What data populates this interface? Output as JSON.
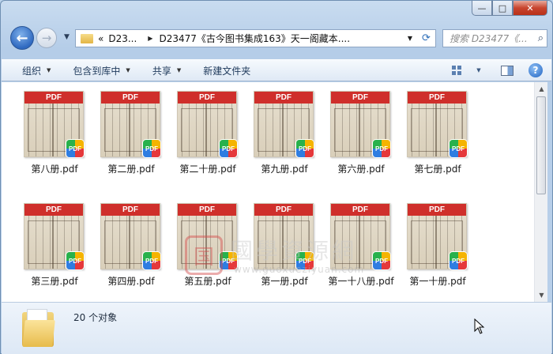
{
  "window": {
    "caption_buttons": {
      "minimize": "—",
      "maximize": "□",
      "close": "✕"
    }
  },
  "nav": {
    "back_glyph": "←",
    "forward_glyph": "→",
    "crumb_prefix": "«",
    "crumbs": [
      "D23...",
      "D23477《古今图书集成163》天一阁藏本...."
    ],
    "search_placeholder": "搜索 D23477《...",
    "refresh_glyph": "⟳"
  },
  "toolbar": {
    "items": [
      "组织",
      "包含到库中",
      "共享",
      "新建文件夹"
    ]
  },
  "files": [
    {
      "name": "第八册.pdf"
    },
    {
      "name": "第二册.pdf"
    },
    {
      "name": "第二十册.pdf"
    },
    {
      "name": "第九册.pdf"
    },
    {
      "name": "第六册.pdf"
    },
    {
      "name": "第七册.pdf"
    },
    {
      "name": "第三册.pdf"
    },
    {
      "name": "第四册.pdf"
    },
    {
      "name": "第五册.pdf"
    },
    {
      "name": "第一册.pdf"
    },
    {
      "name": "第一十八册.pdf"
    },
    {
      "name": "第一十册.pdf"
    }
  ],
  "thumb_band": "PDF",
  "badge": "PDF",
  "watermark": {
    "logo": "国",
    "title": "國學資源網",
    "url": "www.guoxueziyuan.com"
  },
  "details": {
    "count": "20 个对象"
  },
  "colors": {
    "pdf_red": "#cf2f2b",
    "accent": "#2f69c0"
  }
}
